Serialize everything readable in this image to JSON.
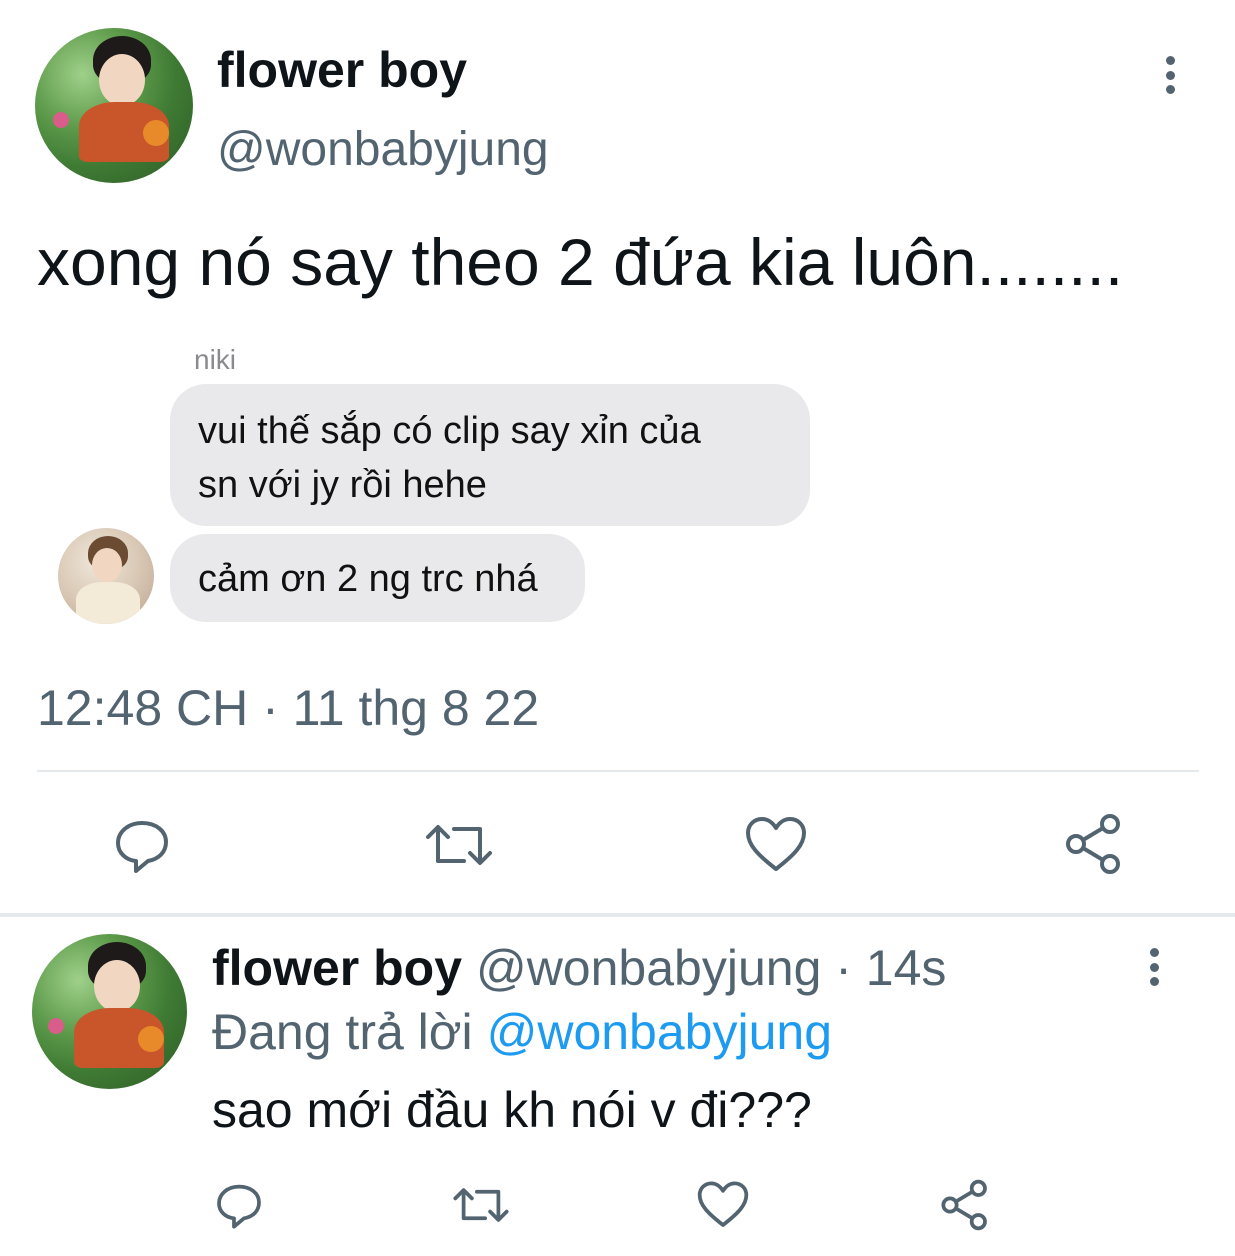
{
  "tweet": {
    "display_name": "flower boy",
    "handle": "@wonbabyjung",
    "text": "xong nó say theo 2 đứa kia luôn........",
    "embedded_chat": {
      "sender": "niki",
      "messages": [
        "vui thế sắp có clip say xỉn của sn với jy rồi hehe",
        "cảm ơn 2 ng trc nhá"
      ]
    },
    "timestamp": "12:48 CH · 11 thg 8 22",
    "actions": [
      "reply-icon",
      "retweet-icon",
      "like-icon",
      "share-icon"
    ]
  },
  "reply": {
    "display_name": "flower boy",
    "handle_time": "@wonbabyjung · 14s",
    "replying_prefix": "Đang trả lời",
    "replying_to": "@wonbabyjung",
    "text": "sao mới đầu kh nói v đi???",
    "actions": [
      "reply-icon",
      "retweet-icon",
      "like-icon",
      "share-icon"
    ]
  },
  "colors": {
    "text": "#0f1419",
    "secondary": "#536471",
    "link": "#1d9bf0",
    "bubble": "#e9e9eb",
    "divider": "#e6e9ec"
  }
}
